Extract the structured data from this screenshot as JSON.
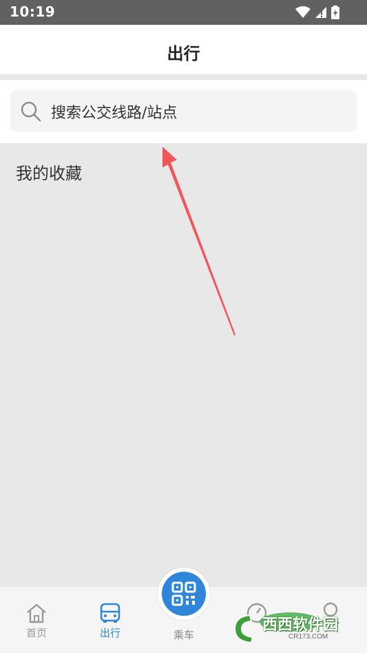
{
  "status_bar": {
    "time": "10:19"
  },
  "header": {
    "title": "出行"
  },
  "search": {
    "placeholder": "搜索公交线路/站点"
  },
  "favorites": {
    "title": "我的收藏"
  },
  "tabbar": {
    "tabs": [
      {
        "label": "首页",
        "icon": "home-icon",
        "active": false
      },
      {
        "label": "出行",
        "icon": "bus-icon",
        "active": true
      },
      {
        "label": "乘车",
        "icon": "qr-code-icon",
        "active": false
      },
      {
        "label": "",
        "icon": "speedometer-icon",
        "active": false
      },
      {
        "label": "",
        "icon": "profile-icon",
        "active": false
      }
    ]
  },
  "watermark": {
    "brand": "西西软件园",
    "domain": "CR173.COM"
  },
  "colors": {
    "accent": "#2f86d8",
    "inactive": "#999999",
    "annotation_arrow": "#f0555a"
  }
}
